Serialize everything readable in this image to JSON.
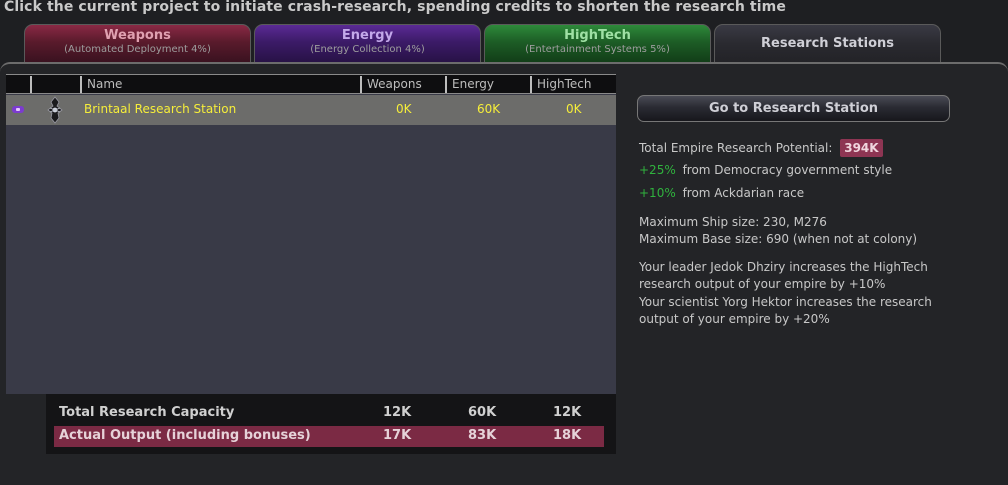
{
  "hint": "Click the current project to initiate crash-research, spending credits to shorten the research time",
  "tabs": [
    {
      "title": "Weapons",
      "subtitle": "(Automated Deployment 4%)"
    },
    {
      "title": "Energy",
      "subtitle": "(Energy Collection 4%)"
    },
    {
      "title": "HighTech",
      "subtitle": "(Entertainment Systems 5%)"
    },
    {
      "title": "Research Stations",
      "subtitle": ""
    }
  ],
  "table": {
    "headers": [
      "Name",
      "Weapons",
      "Energy",
      "HighTech"
    ],
    "rows": [
      {
        "name": "Brintaal Research Station",
        "weapons": "0K",
        "energy": "60K",
        "hightech": "0K"
      }
    ]
  },
  "totals": {
    "capacity": {
      "label": "Total Research Capacity",
      "weapons": "12K",
      "energy": "60K",
      "hightech": "12K"
    },
    "output": {
      "label": "Actual Output (including bonuses)",
      "weapons": "17K",
      "energy": "83K",
      "hightech": "18K"
    }
  },
  "goto_button": "Go to Research Station",
  "info": {
    "potential_label": "Total Empire Research Potential:",
    "potential_value": "394K",
    "bonus1_value": "+25%",
    "bonus1_text": "from Democracy government style",
    "bonus2_value": "+10%",
    "bonus2_text": "from Ackdarian race",
    "max_ship": "Maximum Ship size: 230, M276",
    "max_base": "Maximum Base size: 690 (when not at colony)",
    "leader_line1": "Your leader Jedok Dhziry increases the HighTech",
    "leader_line2": "research output of your empire by +10%",
    "scientist_line1": "Your scientist Yorg Hektor increases the research",
    "scientist_line2": "output of your empire by +20%"
  },
  "colors": {
    "weapons": "#8a2945",
    "energy": "#5b2a95",
    "hightech": "#2e8a3a",
    "highlight": "#7b2a44",
    "row_text": "#f6ee3a",
    "bonus_green": "#30b23e"
  },
  "icons": {
    "row_badge": "empire-flag-icon",
    "row_ship": "research-station-icon"
  }
}
